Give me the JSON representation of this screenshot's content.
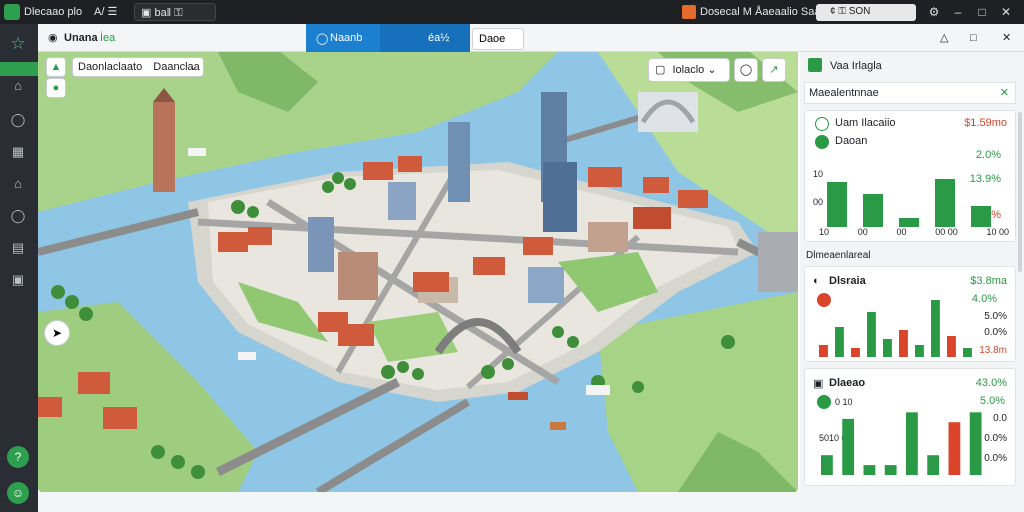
{
  "titlebar": {
    "app_name": "Dlecaao plo",
    "tab1": "A/ ☰",
    "tab2": "▣ baǁ ⚿",
    "right_text": "Dosecal M Åaeaalio Saaacloro",
    "search": "¢ ⚿ SON"
  },
  "topstrip": {
    "page_title": "Unana",
    "page_sub": "İea",
    "blue_tab": "Naanb",
    "blue_tab2": "éa½",
    "button_label": "Daoe"
  },
  "map_controls": {
    "dropdown_label": "Daonlaclaato",
    "dropdown_value": "Daanclaa",
    "filter_label": "Iolaclo"
  },
  "panel": {
    "title": "Vaa Irlagla",
    "search_value": "Maealentnnae",
    "card1": {
      "item1": "Uam Ilacaiio",
      "item1_value": "$1.59mo",
      "item2": "Daoan",
      "item2_value": "2.0%",
      "y_ticks": [
        "10",
        "00"
      ],
      "values_right": [
        "13.9%",
        "5.0%"
      ],
      "bars": [
        0.75,
        0.55,
        0.15,
        0.8,
        0.35
      ],
      "x_labels": [
        "10",
        "00",
        "00",
        "00 00",
        "10 00"
      ]
    },
    "card2_label": "Dlmeaenlareal",
    "card2": {
      "title": "Dlsraia",
      "value": "$3.8ma",
      "value2": "4.0%",
      "ticks": [
        "5.0%",
        "0.0%",
        "13.8m"
      ],
      "bars": [
        0.2,
        0.5,
        0.15,
        0.75,
        0.3,
        0.45,
        0.2,
        0.95,
        0.35,
        0.15
      ]
    },
    "card3": {
      "title": "Dlaeao",
      "value": "43.0%",
      "value2": "5.0%",
      "ticks": [
        "0.0",
        "0.0%",
        "0.0%"
      ],
      "left_items": [
        "0 10",
        "5010 00"
      ],
      "bars": [
        0.3,
        0.85,
        0.15,
        0.15,
        0.95,
        0.3,
        0.8,
        0.95
      ]
    }
  },
  "colors": {
    "accent": "#1d7fd0",
    "green": "#2a9a46",
    "red": "#d9442b"
  }
}
